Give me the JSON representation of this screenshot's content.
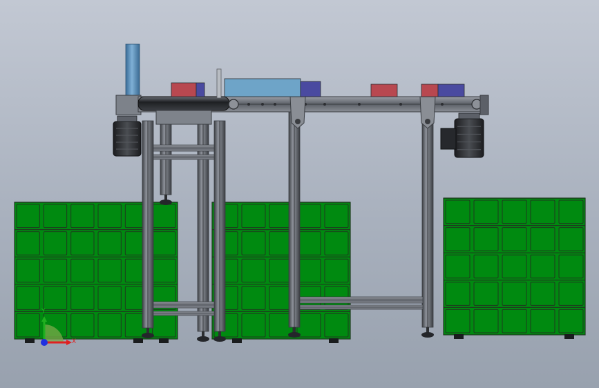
{
  "viewport": {
    "background_top": "#c2c8d3",
    "background_bottom": "#98a1ae"
  },
  "colors": {
    "pallet_green": "#008a10",
    "pallet_line": "#1e3a1e",
    "frame_steel": "#70747c",
    "frame_dark": "#3a3d42",
    "motor_dark": "#2a2c30",
    "blue_cylinder": "#4e86b4",
    "box_red": "#b84850",
    "box_blue": "#4a4aa0",
    "box_light_blue": "#6ea4c8"
  },
  "pallet_stacks": [
    {
      "id": "left",
      "rows": 5,
      "cols": 6
    },
    {
      "id": "middle",
      "rows": 5,
      "cols": 5
    },
    {
      "id": "right",
      "rows": 5,
      "cols": 5
    }
  ],
  "triad": {
    "x_label": "X",
    "y_label": "Y",
    "x_color": "#e02020",
    "y_color": "#20b020",
    "z_color": "#2030e0"
  }
}
